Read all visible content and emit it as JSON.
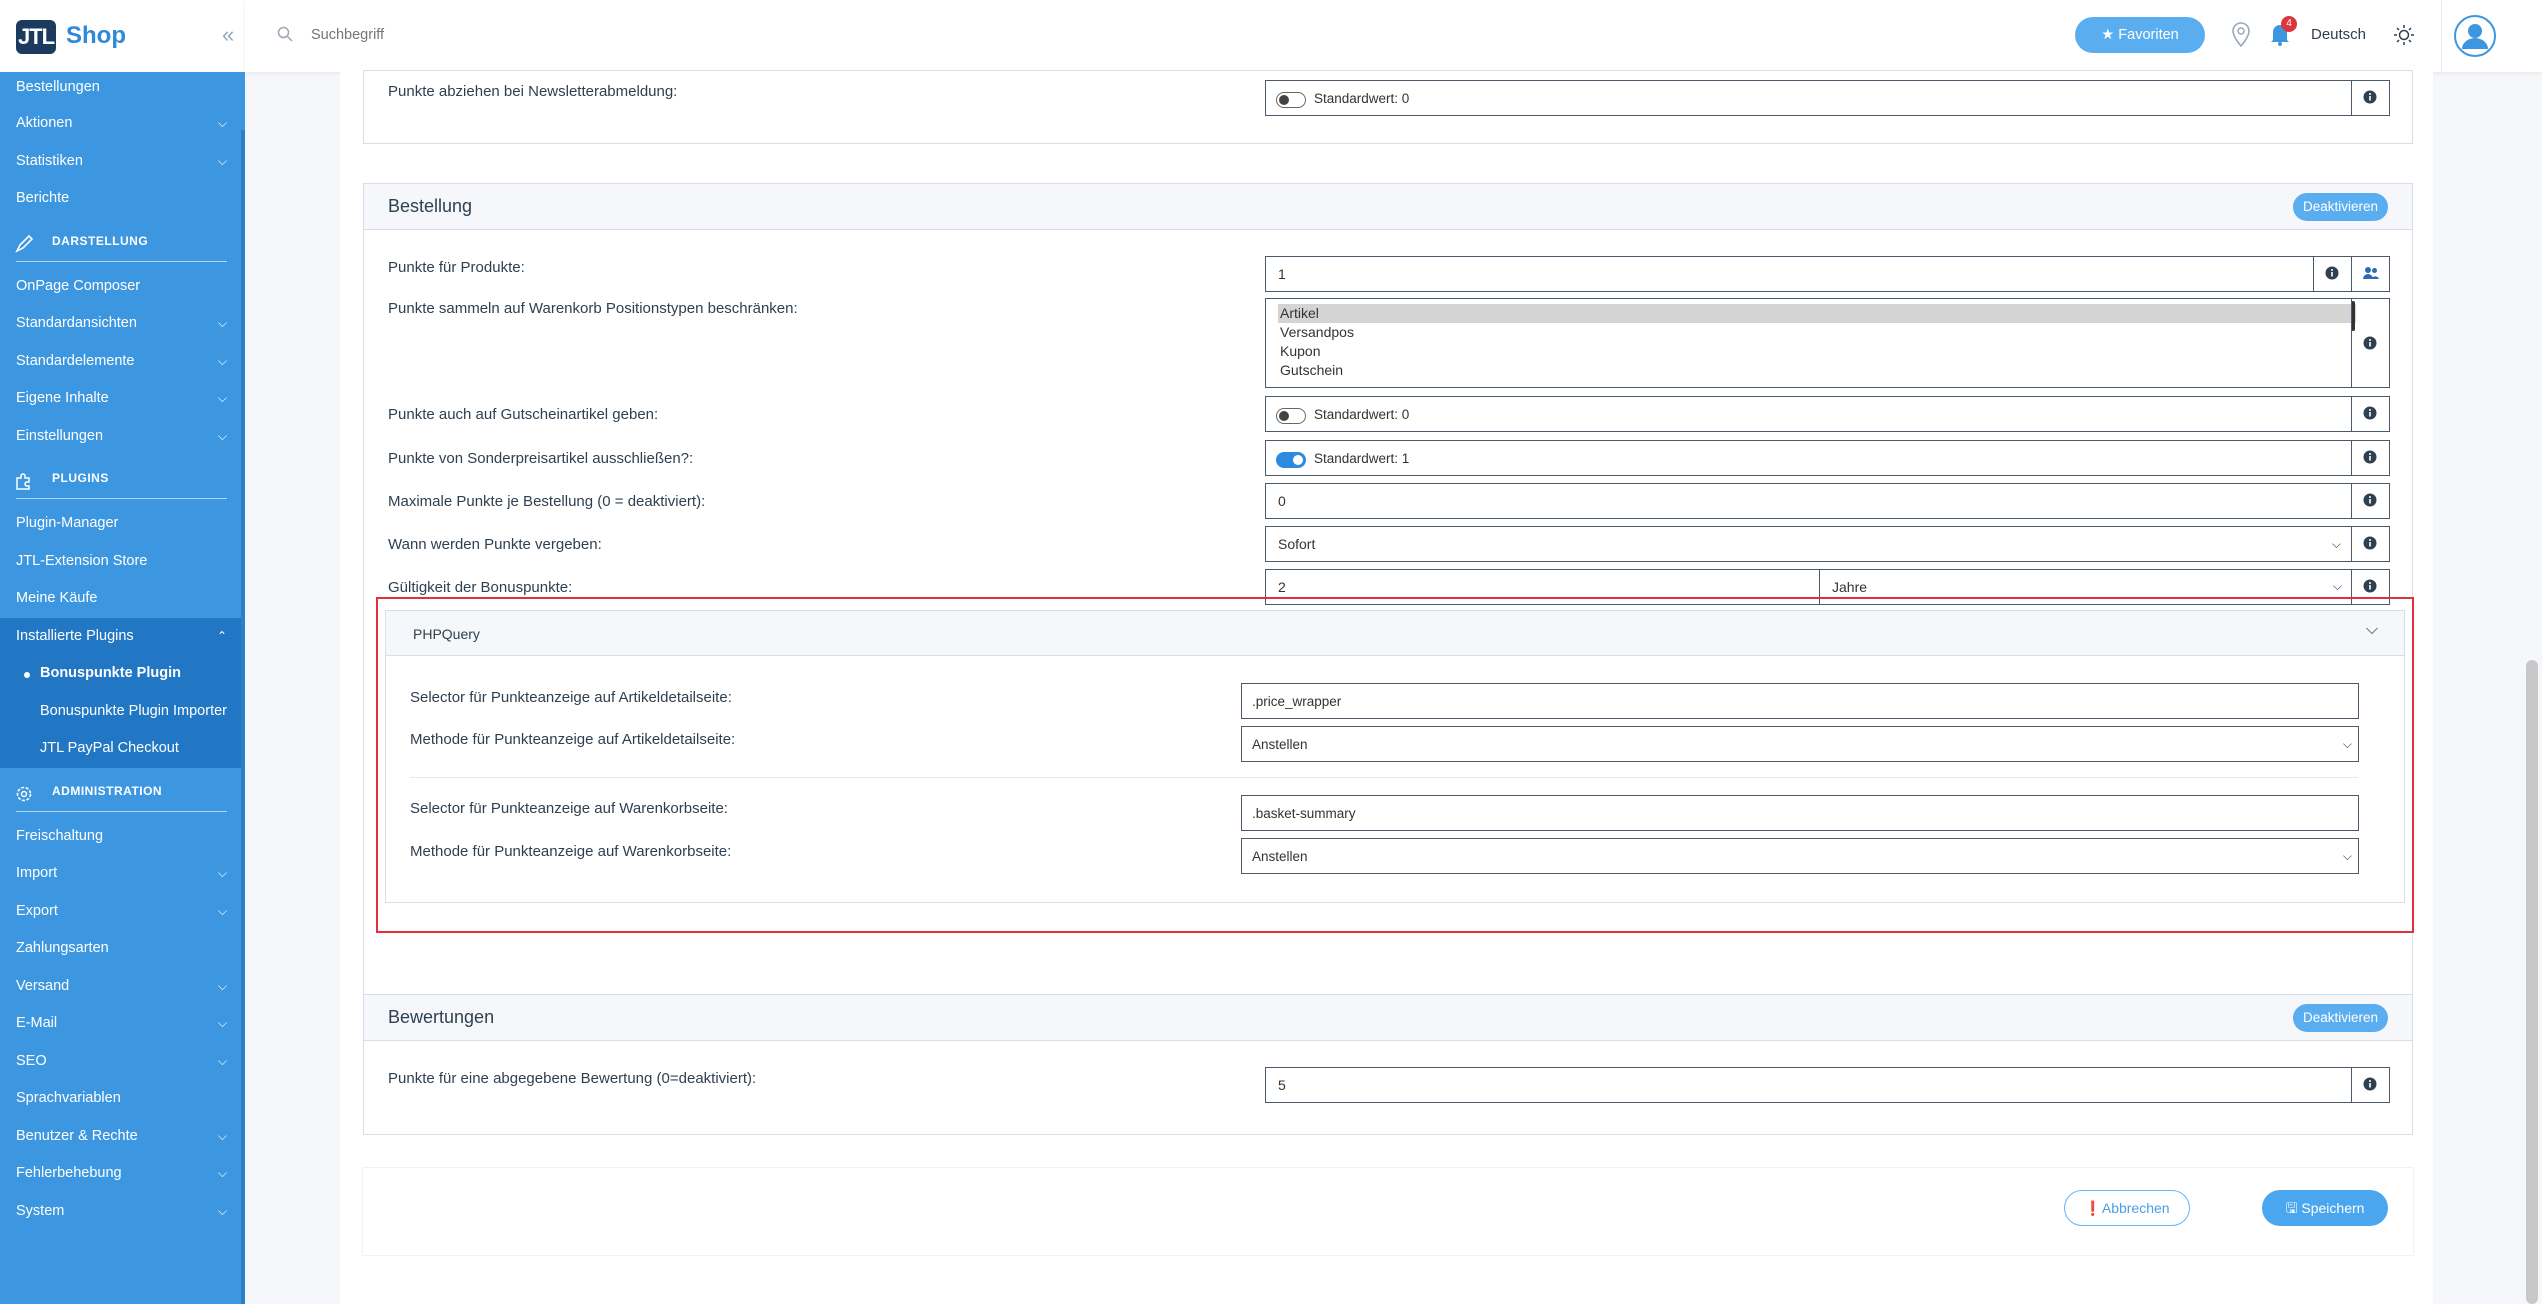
{
  "brand": {
    "logo_mark": "JTL",
    "name": "Shop",
    "collapse": "«"
  },
  "sidebar": {
    "items_top": [
      {
        "label": "Bestellungen",
        "chevron": false
      },
      {
        "label": "Aktionen",
        "chevron": true
      },
      {
        "label": "Statistiken",
        "chevron": true
      },
      {
        "label": "Berichte",
        "chevron": false
      }
    ],
    "section_darstellung": "DARSTELLUNG",
    "items_darstellung": [
      {
        "label": "OnPage Composer",
        "chevron": false
      },
      {
        "label": "Standardansichten",
        "chevron": true
      },
      {
        "label": "Standardelemente",
        "chevron": true
      },
      {
        "label": "Eigene Inhalte",
        "chevron": true
      },
      {
        "label": "Einstellungen",
        "chevron": true
      }
    ],
    "section_plugins": "PLUGINS",
    "items_plugins": [
      {
        "label": "Plugin-Manager"
      },
      {
        "label": "JTL-Extension Store"
      },
      {
        "label": "Meine Käufe"
      }
    ],
    "installed_plugins": "Installierte Plugins",
    "installed_sub": [
      {
        "label": "Bonuspunkte Plugin"
      },
      {
        "label": "Bonuspunkte Plugin Importer"
      },
      {
        "label": "JTL PayPal Checkout"
      }
    ],
    "section_admin": "ADMINISTRATION",
    "items_admin": [
      {
        "label": "Freischaltung",
        "chevron": false
      },
      {
        "label": "Import",
        "chevron": true
      },
      {
        "label": "Export",
        "chevron": true
      },
      {
        "label": "Zahlungsarten",
        "chevron": false
      },
      {
        "label": "Versand",
        "chevron": true
      },
      {
        "label": "E-Mail",
        "chevron": true
      },
      {
        "label": "SEO",
        "chevron": true
      },
      {
        "label": "Sprachvariablen",
        "chevron": false
      },
      {
        "label": "Benutzer & Rechte",
        "chevron": true
      },
      {
        "label": "Fehlerbehebung",
        "chevron": true
      },
      {
        "label": "System",
        "chevron": true
      }
    ]
  },
  "header": {
    "search_placeholder": "Suchbegriff",
    "favorites": "★ Favoriten",
    "notification_count": "4",
    "language": "Deutsch"
  },
  "top_row": {
    "label": "Punkte abziehen bei Newsletterabmeldung:",
    "toggle_text": "Standardwert: 0"
  },
  "bestellung": {
    "title": "Bestellung",
    "deactivate": "Deaktivieren",
    "rows": {
      "punkte_produkte": {
        "label": "Punkte für Produkte:",
        "value": "1"
      },
      "positionstypen": {
        "label": "Punkte sammeln auf Warenkorb Positionstypen beschränken:",
        "options": [
          "Artikel",
          "Versandpos",
          "Kupon",
          "Gutschein"
        ]
      },
      "gutschein": {
        "label": "Punkte auch auf Gutscheinartikel geben:",
        "toggle_text": "Standardwert: 0"
      },
      "sonderpreis": {
        "label": "Punkte von Sonderpreisartikel ausschließen?:",
        "toggle_text": "Standardwert: 1"
      },
      "max_punkte": {
        "label": "Maximale Punkte je Bestellung (0 = deaktiviert):",
        "value": "0"
      },
      "wann": {
        "label": "Wann werden Punkte vergeben:",
        "value": "Sofort"
      },
      "gueltigkeit": {
        "label": "Gültigkeit der Bonuspunkte:",
        "value": "2",
        "unit": "Jahre"
      }
    }
  },
  "phpquery": {
    "title": "PHPQuery",
    "sel_artikel_label": "Selector für Punkteanzeige auf Artikeldetailseite:",
    "sel_artikel_value": ".price_wrapper",
    "meth_artikel_label": "Methode für Punkteanzeige auf Artikeldetailseite:",
    "meth_artikel_value": "Anstellen",
    "sel_warenkorb_label": "Selector für Punkteanzeige auf Warenkorbseite:",
    "sel_warenkorb_value": ".basket-summary",
    "meth_warenkorb_label": "Methode für Punkteanzeige auf Warenkorbseite:",
    "meth_warenkorb_value": "Anstellen"
  },
  "bewertungen": {
    "title": "Bewertungen",
    "deactivate": "Deaktivieren",
    "label": "Punkte für eine abgegebene Bewertung (0=deaktiviert):",
    "value": "5"
  },
  "footer": {
    "cancel": "Abbrechen",
    "save": "Speichern"
  },
  "colors": {
    "sidebar": "#3d97e0",
    "sidebar_active": "#2277c4",
    "accent": "#5aaef0",
    "highlight_frame": "#e0323c"
  }
}
